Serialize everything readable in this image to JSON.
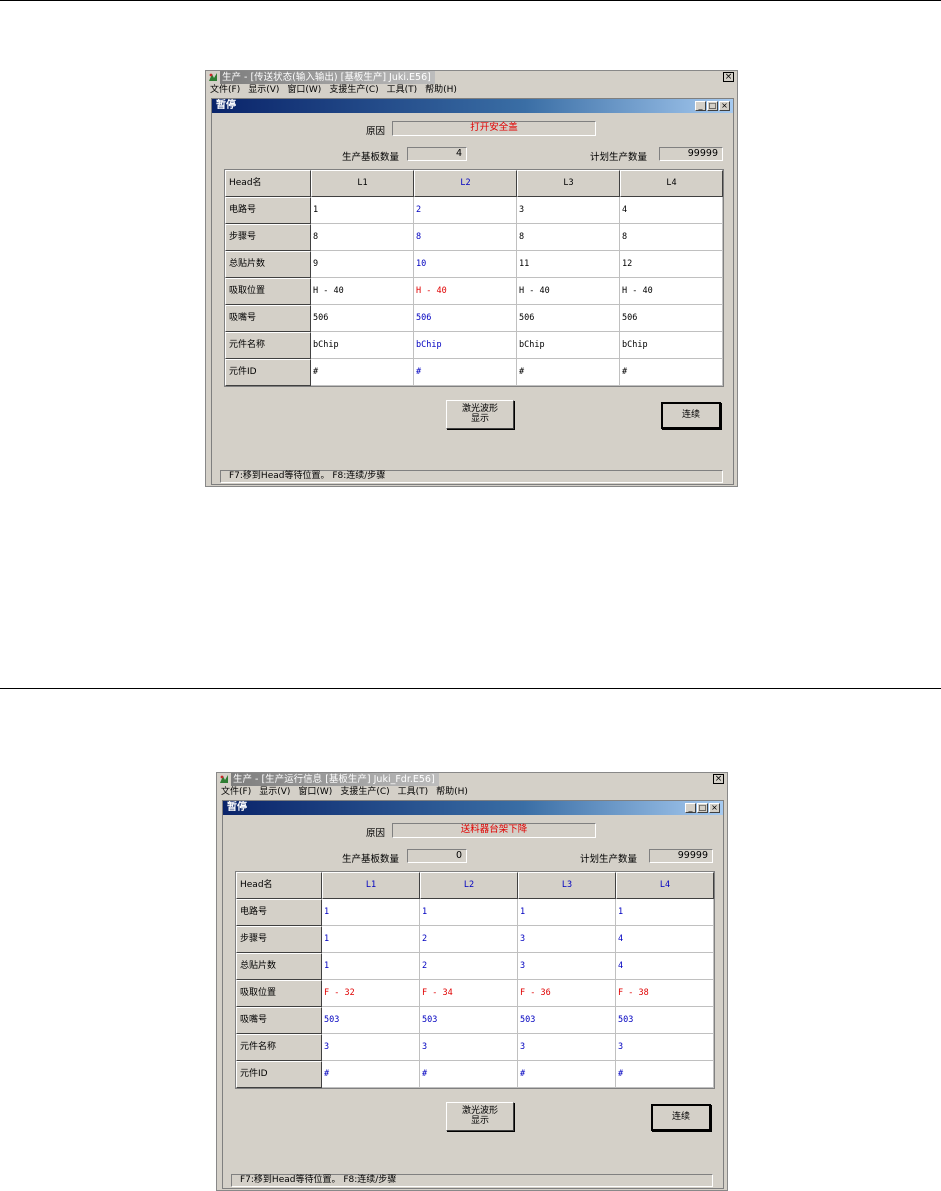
{
  "screens": [
    {
      "app_title": "生产 - [传送状态(输入输出) [基板生产] Juki.E56]",
      "menu": [
        "文件(F)",
        "显示(V)",
        "窗口(W)",
        "支援生产(C)",
        "工具(T)",
        "帮助(H)"
      ],
      "window_title": "暂停",
      "reason_label": "原因",
      "reason_value": "打开安全盖",
      "produced_label": "生产基板数量",
      "produced_value": "4",
      "planned_label": "计划生产数量",
      "planned_value": "99999",
      "head_label": "Head名",
      "columns": [
        "L1",
        "L2",
        "L3",
        "L4"
      ],
      "column_colors": [
        "#000000",
        "#0000c0",
        "#000000",
        "#000000"
      ],
      "rows": [
        {
          "label": "电路号",
          "values": [
            "1",
            "2",
            "3",
            "4"
          ],
          "colors": [
            "#000000",
            "#0000c0",
            "#000000",
            "#000000"
          ]
        },
        {
          "label": "步骤号",
          "values": [
            "8",
            "8",
            "8",
            "8"
          ],
          "colors": [
            "#000000",
            "#0000c0",
            "#000000",
            "#000000"
          ]
        },
        {
          "label": "总贴片数",
          "values": [
            "9",
            "10",
            "11",
            "12"
          ],
          "colors": [
            "#000000",
            "#0000c0",
            "#000000",
            "#000000"
          ]
        },
        {
          "label": "吸取位置",
          "values": [
            "H - 40",
            "H - 40",
            "H - 40",
            "H - 40"
          ],
          "colors": [
            "#000000",
            "#e00000",
            "#000000",
            "#000000"
          ]
        },
        {
          "label": "吸嘴号",
          "values": [
            "506",
            "506",
            "506",
            "506"
          ],
          "colors": [
            "#000000",
            "#0000c0",
            "#000000",
            "#000000"
          ]
        },
        {
          "label": "元件名称",
          "values": [
            "bChip",
            "bChip",
            "bChip",
            "bChip"
          ],
          "colors": [
            "#000000",
            "#0000c0",
            "#000000",
            "#000000"
          ]
        },
        {
          "label": "元件ID",
          "values": [
            "#",
            "#",
            "#",
            "#"
          ],
          "colors": [
            "#000000",
            "#0000c0",
            "#000000",
            "#000000"
          ]
        }
      ],
      "laser_button": "激光波形\n显示",
      "continue_button": "连续",
      "status_text": "F7:移到Head等待位置。  F8:连续/步骤"
    },
    {
      "app_title": "生产 - [生产运行信息 [基板生产] Juki_Fdr.E56]",
      "menu": [
        "文件(F)",
        "显示(V)",
        "窗口(W)",
        "支援生产(C)",
        "工具(T)",
        "帮助(H)"
      ],
      "window_title": "暂停",
      "reason_label": "原因",
      "reason_value": "送料器台架下降",
      "produced_label": "生产基板数量",
      "produced_value": "0",
      "planned_label": "计划生产数量",
      "planned_value": "99999",
      "head_label": "Head名",
      "columns": [
        "L1",
        "L2",
        "L3",
        "L4"
      ],
      "column_colors": [
        "#0000c0",
        "#0000c0",
        "#0000c0",
        "#0000c0"
      ],
      "rows": [
        {
          "label": "电路号",
          "values": [
            "1",
            "1",
            "1",
            "1"
          ],
          "colors": [
            "#0000c0",
            "#0000c0",
            "#0000c0",
            "#0000c0"
          ]
        },
        {
          "label": "步骤号",
          "values": [
            "1",
            "2",
            "3",
            "4"
          ],
          "colors": [
            "#0000c0",
            "#0000c0",
            "#0000c0",
            "#0000c0"
          ]
        },
        {
          "label": "总贴片数",
          "values": [
            "1",
            "2",
            "3",
            "4"
          ],
          "colors": [
            "#0000c0",
            "#0000c0",
            "#0000c0",
            "#0000c0"
          ]
        },
        {
          "label": "吸取位置",
          "values": [
            "F - 32",
            "F - 34",
            "F - 36",
            "F - 38"
          ],
          "colors": [
            "#e00000",
            "#e00000",
            "#e00000",
            "#e00000"
          ]
        },
        {
          "label": "吸嘴号",
          "values": [
            "503",
            "503",
            "503",
            "503"
          ],
          "colors": [
            "#0000c0",
            "#0000c0",
            "#0000c0",
            "#0000c0"
          ]
        },
        {
          "label": "元件名称",
          "values": [
            "3",
            "3",
            "3",
            "3"
          ],
          "colors": [
            "#0000c0",
            "#0000c0",
            "#0000c0",
            "#0000c0"
          ]
        },
        {
          "label": "元件ID",
          "values": [
            "#",
            "#",
            "#",
            "#"
          ],
          "colors": [
            "#0000c0",
            "#0000c0",
            "#0000c0",
            "#0000c0"
          ]
        }
      ],
      "laser_button": "激光波形\n显示",
      "continue_button": "连续",
      "status_text": "F7:移到Head等待位置。  F8:连续/步骤"
    }
  ]
}
